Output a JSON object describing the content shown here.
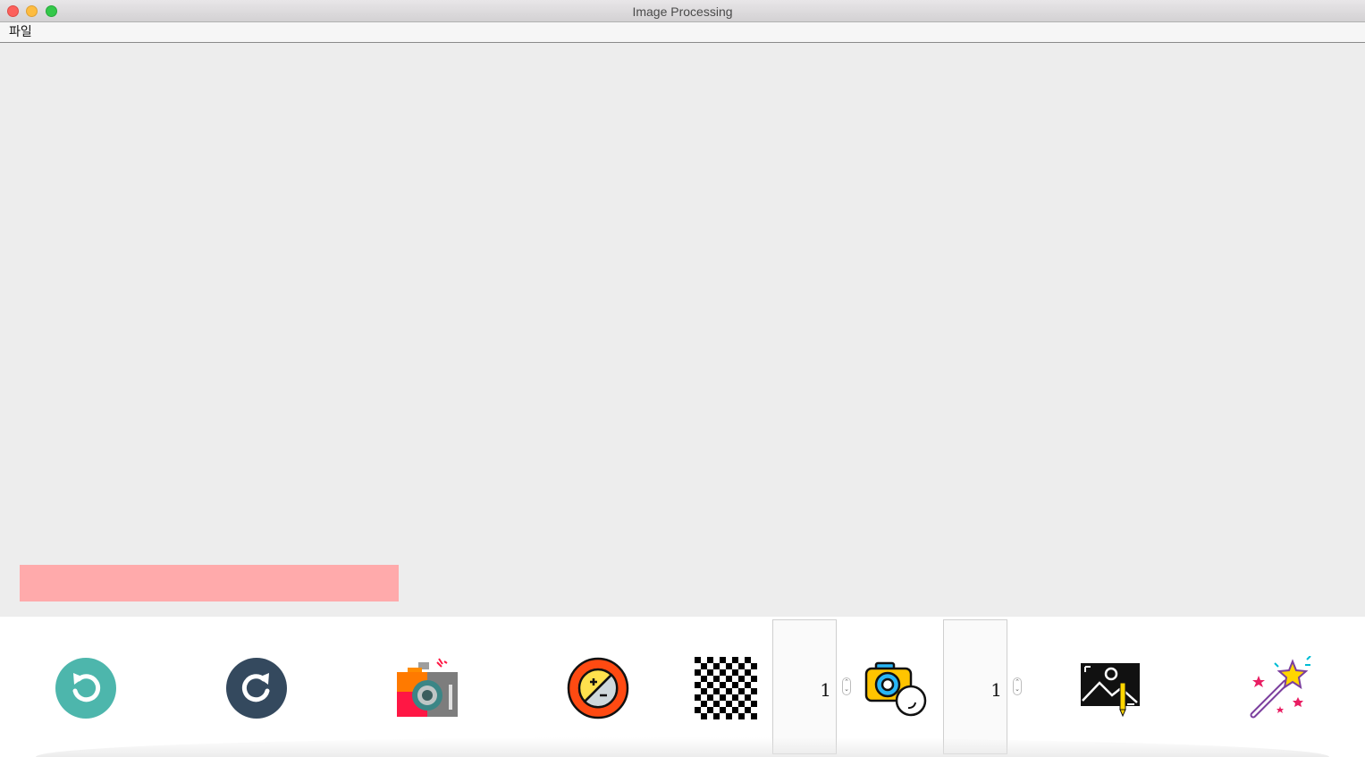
{
  "window": {
    "title": "Image Processing"
  },
  "menubar": {
    "items": [
      {
        "label": "파일"
      }
    ]
  },
  "status": {
    "color": "#ffaaab"
  },
  "toolbar": {
    "tools": [
      {
        "name": "rotate-left",
        "icon": "rotate-left-icon",
        "color": "#4db6ac"
      },
      {
        "name": "rotate-right",
        "icon": "rotate-right-icon",
        "color": "#34495e"
      },
      {
        "name": "camera-color",
        "icon": "camera-color-icon"
      },
      {
        "name": "exposure",
        "icon": "exposure-icon",
        "color": "#ff4a12"
      },
      {
        "name": "mosaic",
        "icon": "checkerboard-icon"
      },
      {
        "name": "camera-filter",
        "icon": "camera-lens-icon"
      },
      {
        "name": "image-edit",
        "icon": "image-edit-icon"
      },
      {
        "name": "magic-wand",
        "icon": "magic-wand-icon"
      }
    ],
    "spinbox_1": {
      "value": "1"
    },
    "spinbox_2": {
      "value": "1"
    }
  }
}
